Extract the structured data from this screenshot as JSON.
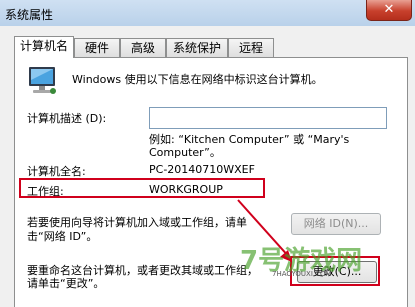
{
  "window": {
    "title": "系统属性",
    "close_glyph": "✕"
  },
  "tabs": [
    "计算机名",
    "硬件",
    "高级",
    "系统保护",
    "远程"
  ],
  "intro": "Windows 使用以下信息在网络中标识这台计算机。",
  "description": {
    "label": "计算机描述 (D):",
    "value": "",
    "example_line1": "例如: “Kitchen Computer” 或 “Mary's",
    "example_line2": "Computer”。"
  },
  "full_name": {
    "label": "计算机全名:",
    "value": "PC-20140710WXEF"
  },
  "workgroup": {
    "label": "工作组:",
    "value": "WORKGROUP"
  },
  "network_id": {
    "text_line1": "若要使用向导将计算机加入域或工作组，请单",
    "text_line2": "击“网络 ID”。",
    "button": "网络 ID(N)..."
  },
  "rename": {
    "text_line1": "要重命名这台计算机，或者更改其域或工作组，",
    "text_line2": "请单击“更改”。",
    "button": "更改(C)..."
  },
  "watermark": {
    "text": "7号游戏网",
    "sub": "7HAOYOUXI.COM"
  }
}
